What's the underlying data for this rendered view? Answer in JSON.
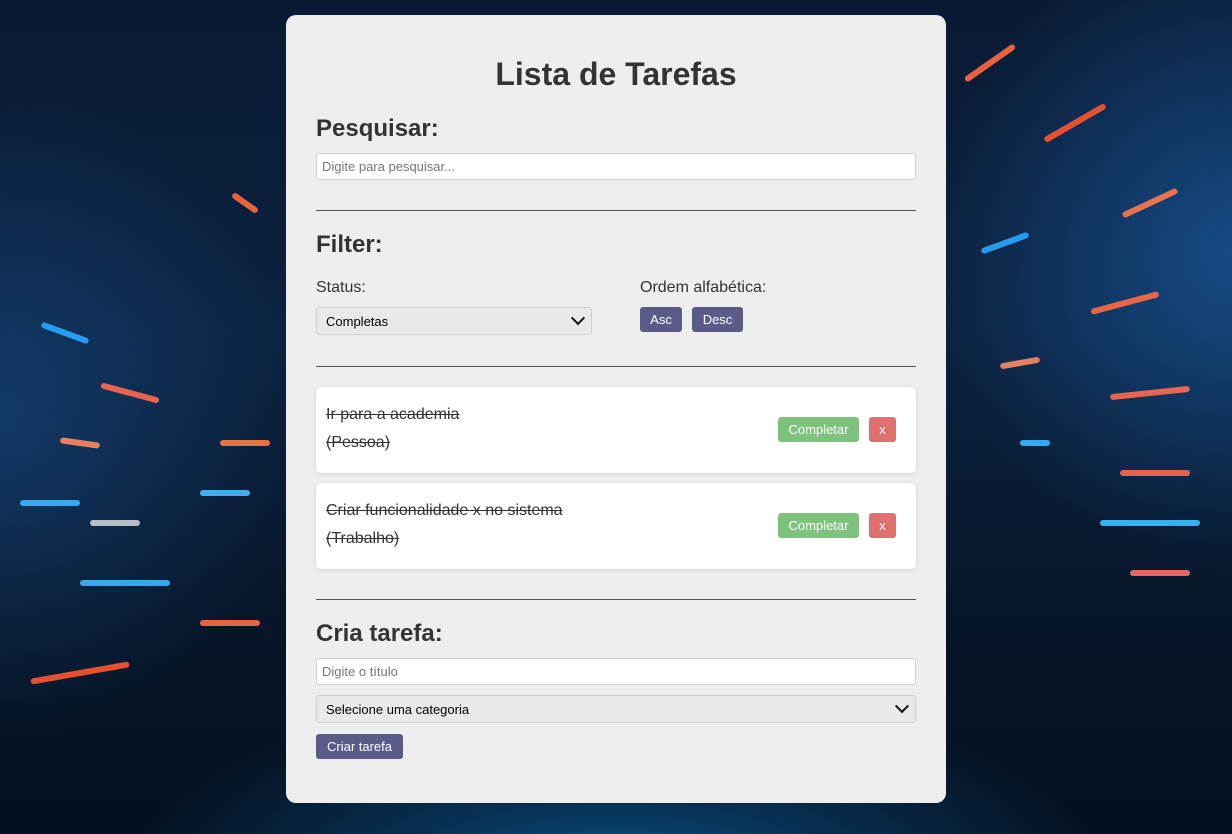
{
  "app": {
    "title": "Lista de Tarefas"
  },
  "search": {
    "heading": "Pesquisar:",
    "placeholder": "Digite para pesquisar..."
  },
  "filter": {
    "heading": "Filter:",
    "status_label": "Status:",
    "status_selected": "Completas",
    "order_label": "Ordem alfabética:",
    "asc_label": "Asc",
    "desc_label": "Desc"
  },
  "tasks": [
    {
      "title": "Ir para a academia",
      "category": "(Pessoa)",
      "complete_label": "Completar",
      "remove_label": "x",
      "completed": true
    },
    {
      "title": "Criar funcionalidade x no sistema",
      "category": "(Trabalho)",
      "complete_label": "Completar",
      "remove_label": "x",
      "completed": true
    }
  ],
  "create": {
    "heading": "Cria tarefa:",
    "title_placeholder": "Digite o título",
    "category_selected": "Selecione uma categoria",
    "submit_label": "Criar tarefa"
  },
  "colors": {
    "primary_button": "#5a5b89",
    "complete_button": "#7ec27e",
    "remove_button": "#e07070",
    "card_background": "#eeeeee"
  }
}
